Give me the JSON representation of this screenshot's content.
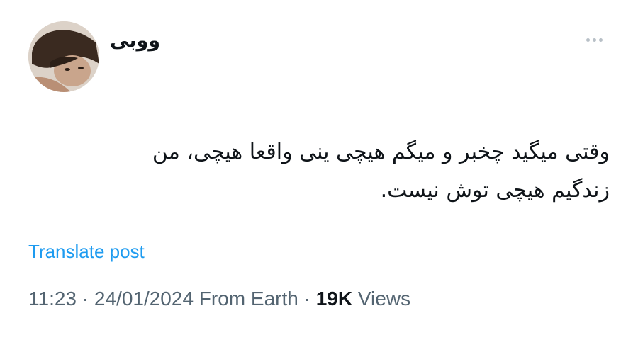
{
  "user": {
    "display_name": "ووبی"
  },
  "tweet": {
    "lines": [
      "وقتی میگید چخبر و میگم هیچی ینی واقعا هیچی، من",
      "زندگیم هیچی توش نیست."
    ]
  },
  "actions": {
    "translate_label": "Translate post"
  },
  "meta": {
    "time": "11:23",
    "separator1": " · ",
    "date": "24/01/2024",
    "source": " From Earth",
    "separator2": " · ",
    "views_count": "19K",
    "views_label": " Views"
  },
  "colors": {
    "link": "#1d9bf0",
    "secondary_text": "#536471",
    "primary_text": "#0f1419"
  },
  "icons": {
    "more": "more-horizontal-icon",
    "avatar": "profile-photo"
  }
}
